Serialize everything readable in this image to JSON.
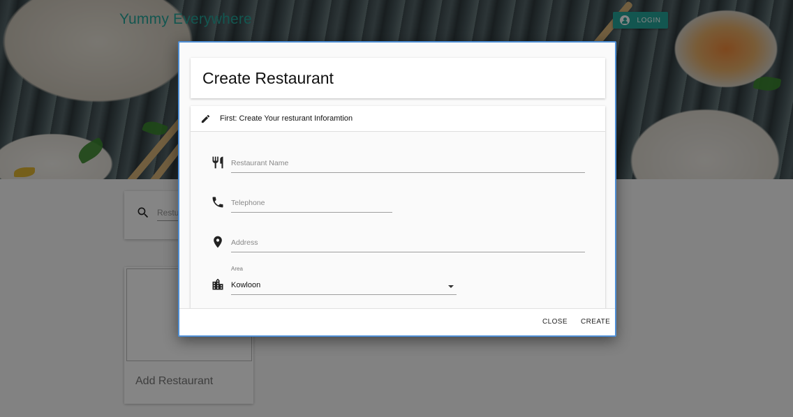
{
  "header": {
    "app_title": "Yummy Everywhere",
    "login_label": "LOGIN",
    "accent_color": "#26a69a"
  },
  "search": {
    "placeholder": "Restu"
  },
  "add_card": {
    "label": "Add Restaurant"
  },
  "modal": {
    "title": "Create Restaurant",
    "section_title": "First: Create Your resturant Inforamtion",
    "fields": {
      "name": {
        "placeholder": "Restaurant Name",
        "icon": "restaurant-icon"
      },
      "telephone": {
        "placeholder": "Telephone",
        "icon": "phone-icon"
      },
      "address": {
        "placeholder": "Address",
        "icon": "location-icon"
      },
      "area": {
        "label": "Area",
        "value": "Kowloon",
        "icon": "city-icon"
      }
    },
    "footer": {
      "close_label": "CLOSE",
      "create_label": "CREATE"
    },
    "border_color": "#4f8fd6"
  }
}
